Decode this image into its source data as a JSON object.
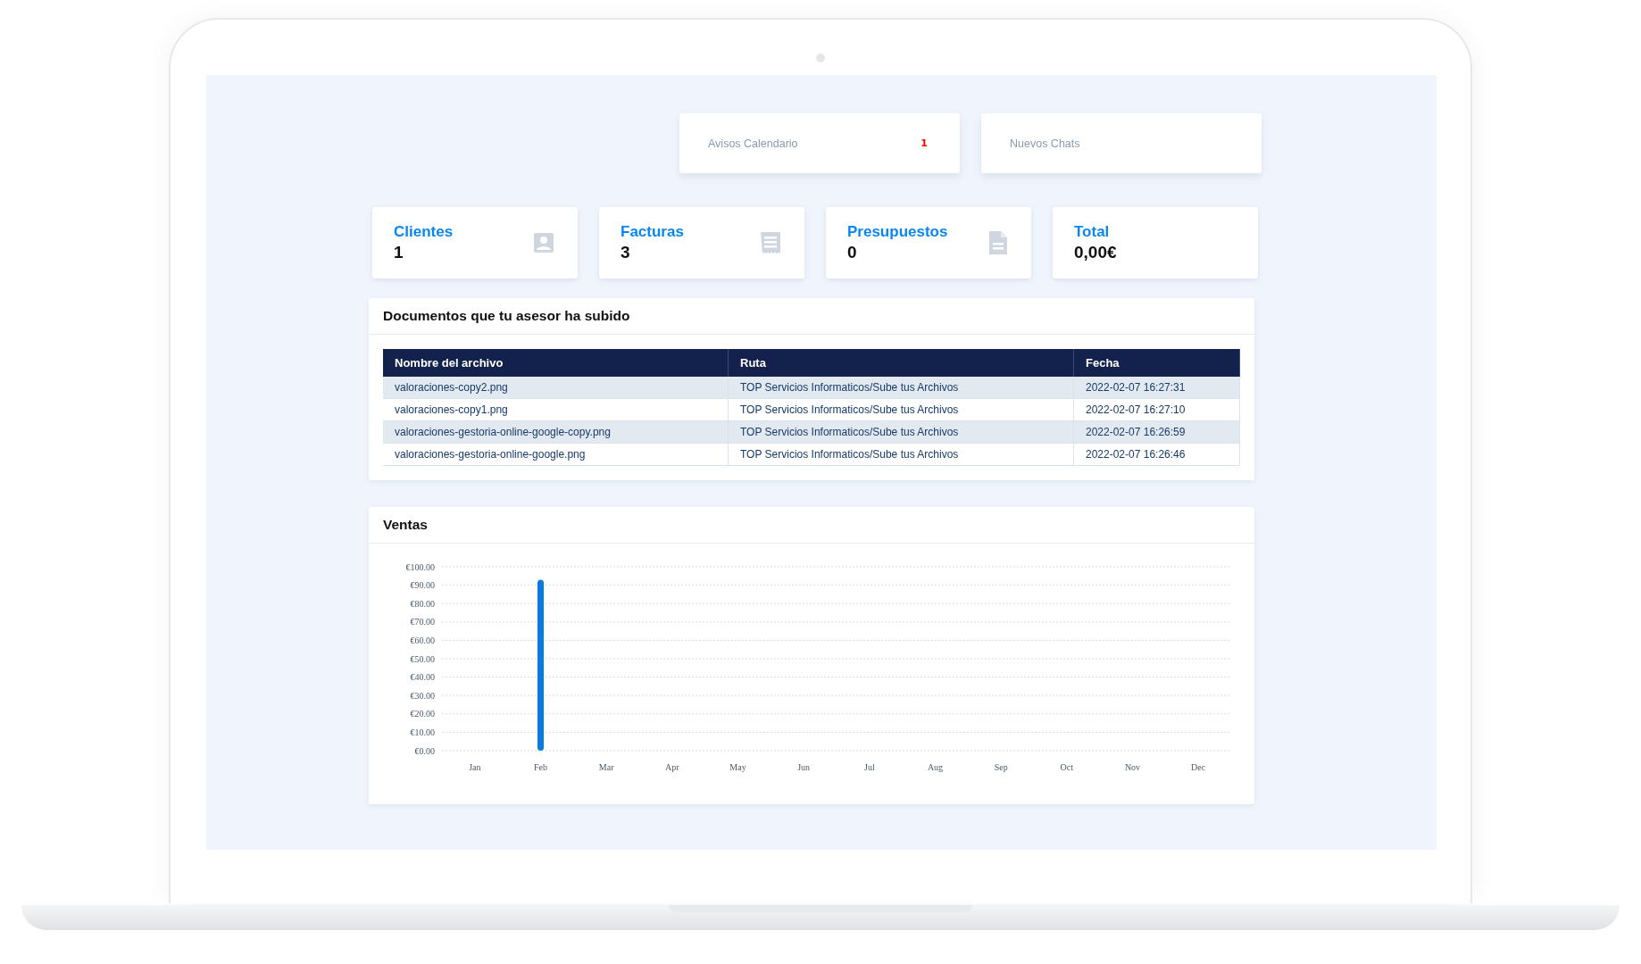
{
  "notices": [
    {
      "label": "Avisos Calendario",
      "count": "1"
    },
    {
      "label": "Nuevos Chats"
    }
  ],
  "stats": [
    {
      "title": "Clientes",
      "value": "1",
      "kind": "contact"
    },
    {
      "title": "Facturas",
      "value": "3",
      "kind": "receipt"
    },
    {
      "title": "Presupuestos",
      "value": "0",
      "kind": "document"
    },
    {
      "title": "Total",
      "value": "0,00€"
    }
  ],
  "documents": {
    "title": "Documentos que tu asesor ha subido",
    "columns": [
      "Nombre del archivo",
      "Ruta",
      "Fecha"
    ],
    "rows": [
      [
        "valoraciones-copy2.png",
        "TOP Servicios Informaticos/Sube tus Archivos",
        "2022-02-07 16:27:31"
      ],
      [
        "valoraciones-copy1.png",
        "TOP Servicios Informaticos/Sube tus Archivos",
        "2022-02-07 16:27:10"
      ],
      [
        "valoraciones-gestoria-online-google-copy.png",
        "TOP Servicios Informaticos/Sube tus Archivos",
        "2022-02-07 16:26:59"
      ],
      [
        "valoraciones-gestoria-online-google.png",
        "TOP Servicios Informaticos/Sube tus Archivos",
        "2022-02-07 16:26:46"
      ]
    ]
  },
  "sales": {
    "title": "Ventas",
    "chart_data": {
      "type": "bar",
      "categories": [
        "Jan",
        "Feb",
        "Mar",
        "Apr",
        "May",
        "Jun",
        "Jul",
        "Aug",
        "Sep",
        "Oct",
        "Nov",
        "Dec"
      ],
      "values": [
        0,
        93,
        0,
        0,
        0,
        0,
        0,
        0,
        0,
        0,
        0,
        0
      ],
      "grid": true,
      "ylim": [
        0,
        100
      ],
      "yticks": [
        {
          "value": 0,
          "label": "€0.00"
        },
        {
          "value": 10,
          "label": "€10.00"
        },
        {
          "value": 20,
          "label": "€20.00"
        },
        {
          "value": 30,
          "label": "€30.00"
        },
        {
          "value": 40,
          "label": "€40.00"
        },
        {
          "value": 50,
          "label": "€50.00"
        },
        {
          "value": 60,
          "label": "€60.00"
        },
        {
          "value": 70,
          "label": "€70.00"
        },
        {
          "value": 80,
          "label": "€80.00"
        },
        {
          "value": 90,
          "label": "€90.00"
        },
        {
          "value": 100,
          "label": "€100.00"
        }
      ]
    }
  }
}
